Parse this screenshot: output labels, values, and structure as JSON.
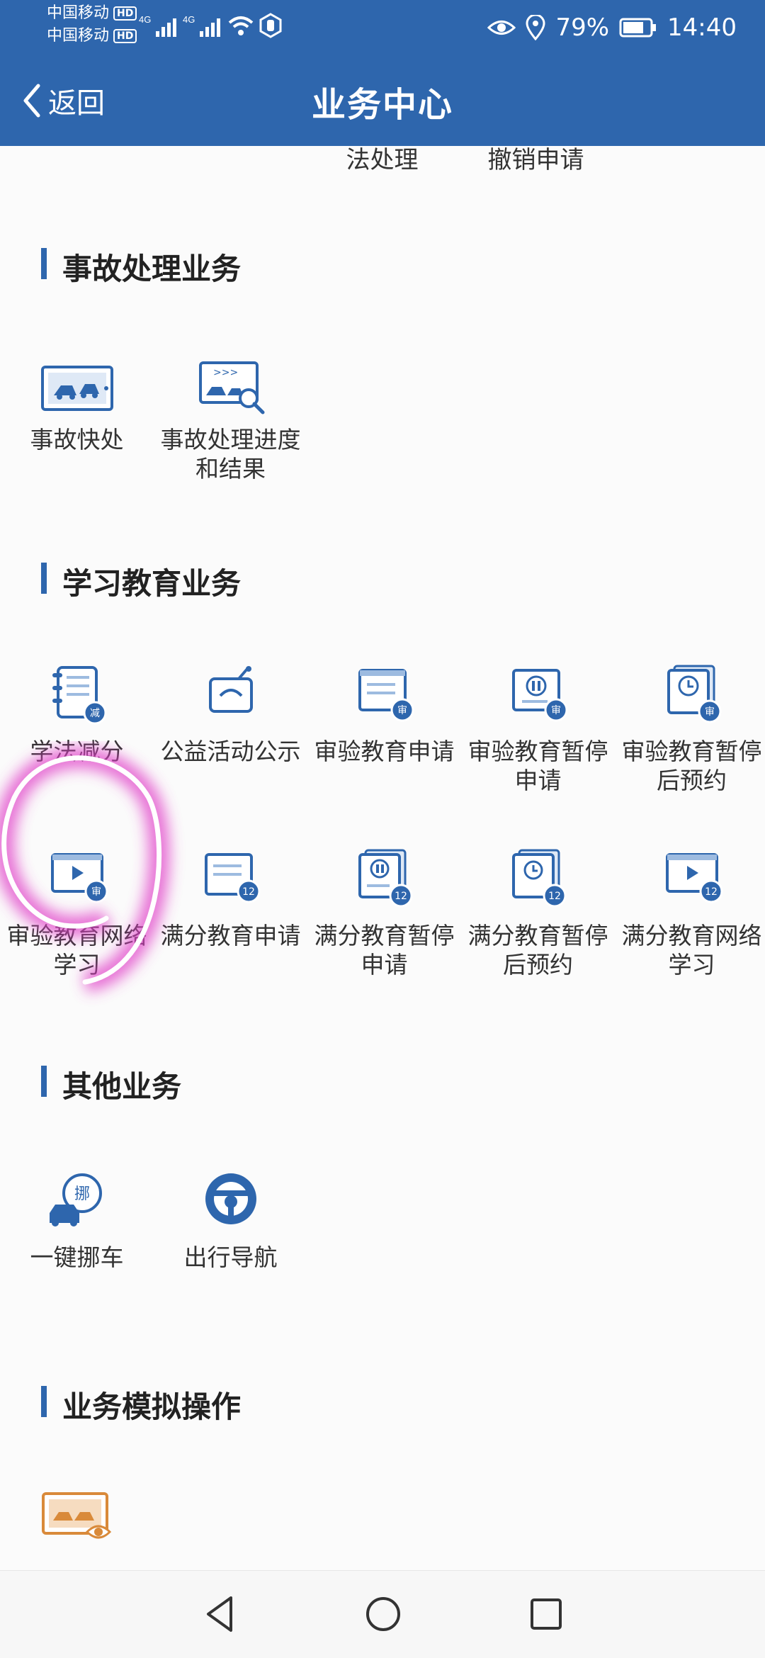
{
  "status_bar": {
    "carrier1": "中国移动",
    "carrier2": "中国移动",
    "hd": "HD",
    "net1": "4G",
    "net2": "4G",
    "battery": "79%",
    "time": "14:40",
    "icons": [
      "signal-icon",
      "wifi-icon",
      "hand-icon",
      "eye-icon",
      "location-icon",
      "battery-icon"
    ]
  },
  "nav": {
    "back": "返回",
    "title": "业务中心"
  },
  "cut_items": [
    "法处理",
    "撤销申请"
  ],
  "sections": [
    {
      "title": "事故处理业务",
      "items": [
        {
          "label": "事故快处",
          "icon": "accident-quick-icon"
        },
        {
          "label": "事故处理进度和结果",
          "icon": "accident-progress-icon"
        }
      ]
    },
    {
      "title": "学习教育业务",
      "items": [
        {
          "label": "学法减分",
          "icon": "study-reduce-icon",
          "badge": "减"
        },
        {
          "label": "公益活动公示",
          "icon": "public-welfare-icon"
        },
        {
          "label": "审验教育申请",
          "icon": "review-edu-apply-icon",
          "badge": "审"
        },
        {
          "label": "审验教育暂停申请",
          "icon": "review-edu-pause-icon",
          "badge": "审"
        },
        {
          "label": "审验教育暂停后预约",
          "icon": "review-edu-appointment-icon",
          "badge": "审"
        },
        {
          "label": "审验教育网络学习",
          "icon": "review-edu-online-icon",
          "badge": "审"
        },
        {
          "label": "满分教育申请",
          "icon": "full-score-apply-icon",
          "badge": "12"
        },
        {
          "label": "满分教育暂停申请",
          "icon": "full-score-pause-icon",
          "badge": "12"
        },
        {
          "label": "满分教育暂停后预约",
          "icon": "full-score-appointment-icon",
          "badge": "12"
        },
        {
          "label": "满分教育网络学习",
          "icon": "full-score-online-icon",
          "badge": "12"
        }
      ]
    },
    {
      "title": "其他业务",
      "items": [
        {
          "label": "一键挪车",
          "icon": "move-car-icon",
          "badge": "挪"
        },
        {
          "label": "出行导航",
          "icon": "navigation-icon"
        }
      ]
    },
    {
      "title": "业务模拟操作",
      "items": [
        {
          "label": "",
          "icon": "simulation-icon"
        }
      ]
    }
  ],
  "colors": {
    "primary": "#2e66ad",
    "accent_orange": "#d98a3a",
    "highlight": "#e040c8"
  }
}
